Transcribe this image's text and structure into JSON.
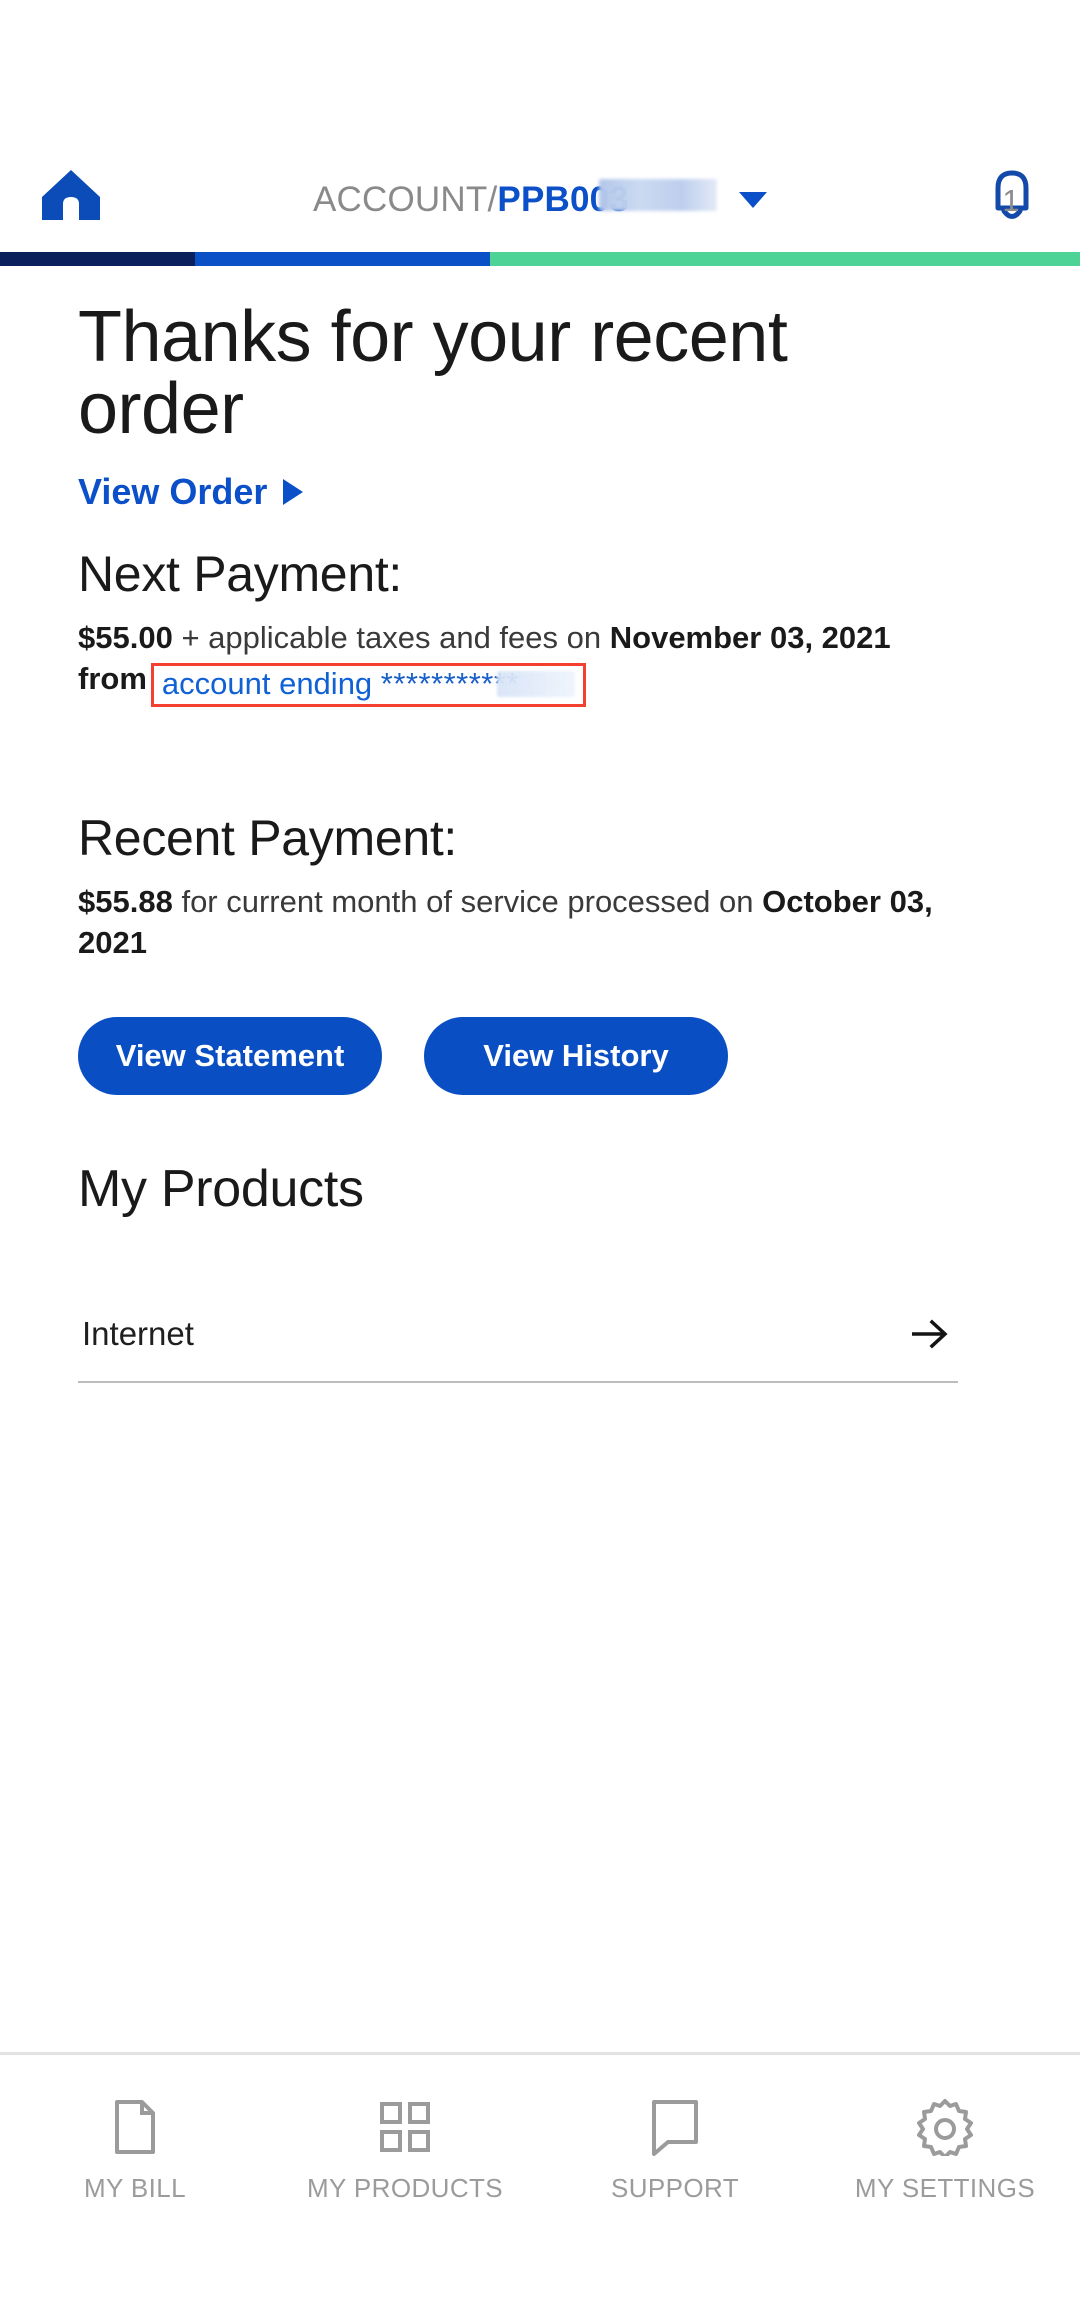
{
  "header": {
    "home_icon": "home-icon",
    "account_prefix": "ACCOUNT/",
    "account_id": "PPB003",
    "account_redacted": true,
    "caret_icon": "chevron-down-icon",
    "bell_icon": "notification-bell-icon",
    "notification_count": "1"
  },
  "progress": {
    "segments": [
      {
        "name": "segment-navy",
        "color": "#0a1f5c",
        "width_pct": 18
      },
      {
        "name": "segment-blue",
        "color": "#0a51c8",
        "width_pct": 27
      },
      {
        "name": "segment-green",
        "color": "#4ed396",
        "width_pct": 55
      }
    ]
  },
  "hero": {
    "title": "Thanks for your recent order",
    "view_order_label": "View Order",
    "view_order_caret": "play-caret-icon"
  },
  "next_payment": {
    "heading": "Next Payment:",
    "amount": "$55.00",
    "middle_text": "+ applicable taxes and fees on",
    "date": "November 03, 2021",
    "from_text": "from",
    "account_link_label": "account ending",
    "account_mask": "***********",
    "highlight_color": "#f3402f"
  },
  "recent_payment": {
    "heading": "Recent Payment:",
    "amount": "$55.88",
    "middle_text": "for current month of service processed on",
    "date": "October 03, 2021"
  },
  "actions": {
    "view_statement_label": "View Statement",
    "view_history_label": "View History",
    "button_color": "#0a4ec4"
  },
  "products": {
    "heading": "My Products",
    "items": [
      {
        "label": "Internet",
        "arrow_icon": "arrow-right-icon"
      }
    ]
  },
  "bottom_nav": {
    "items": [
      {
        "label": "MY BILL",
        "icon": "document-icon"
      },
      {
        "label": "MY PRODUCTS",
        "icon": "grid-icon"
      },
      {
        "label": "SUPPORT",
        "icon": "chat-bubble-icon"
      },
      {
        "label": "MY SETTINGS",
        "icon": "gear-icon"
      }
    ]
  }
}
